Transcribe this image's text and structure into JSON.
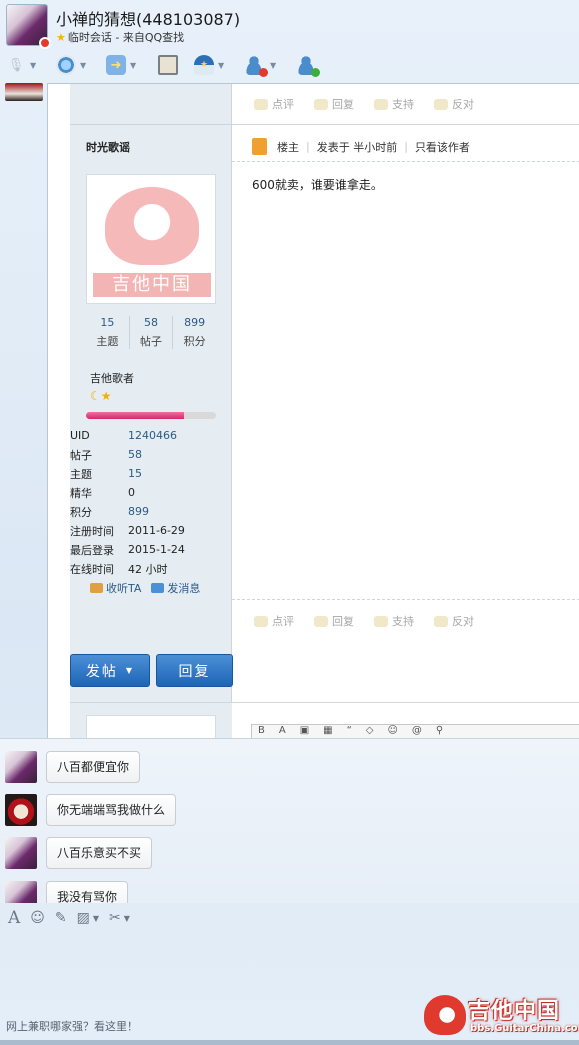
{
  "header": {
    "contact_name": "小禅的猜想(448103087)",
    "subtitle": "临时会话 - 来自QQ查找"
  },
  "toolbar": {
    "items": [
      {
        "icon": "microphone-icon",
        "has_dropdown": true
      },
      {
        "icon": "camera-icon",
        "has_dropdown": true
      },
      {
        "icon": "file-transfer-icon",
        "has_dropdown": true
      },
      {
        "icon": "screen-icon",
        "has_dropdown": false
      },
      {
        "icon": "app-icon",
        "has_dropdown": true
      },
      {
        "icon": "block-user-icon",
        "has_dropdown": true
      },
      {
        "icon": "add-user-icon",
        "has_dropdown": false
      }
    ]
  },
  "forum": {
    "actions": [
      "点评",
      "回复",
      "支持",
      "反对"
    ],
    "poster": {
      "name": "时光歌谣",
      "avatar_text": "吉他中国",
      "stats": [
        {
          "num": "15",
          "label": "主题"
        },
        {
          "num": "58",
          "label": "帖子"
        },
        {
          "num": "899",
          "label": "积分"
        }
      ],
      "rank": "吉他歌者",
      "progress": 0.75,
      "info": [
        {
          "k": "UID",
          "v": "1240466",
          "link": true
        },
        {
          "k": "帖子",
          "v": "58",
          "link": true
        },
        {
          "k": "主题",
          "v": "15",
          "link": true
        },
        {
          "k": "精华",
          "v": "0",
          "link": false
        },
        {
          "k": "积分",
          "v": "899",
          "link": true
        },
        {
          "k": "注册时间",
          "v": "2011-6-29",
          "link": false
        },
        {
          "k": "最后登录",
          "v": "2015-1-24",
          "link": false
        },
        {
          "k": "在线时间",
          "v": "42 小时",
          "link": false
        }
      ],
      "follow_label": "收听TA",
      "message_label": "发消息"
    },
    "post_meta": {
      "floor": "楼主",
      "posted": "发表于 半小时前",
      "only_author": "只看该作者"
    },
    "content": "600就卖，谁要谁拿走。",
    "post_button": "发帖",
    "reply_button": "回复"
  },
  "chat": {
    "messages": [
      {
        "avatar": "boy-avatar",
        "text": "八百都便宜你"
      },
      {
        "avatar": "mask-avatar",
        "text": "你无端端骂我做什么"
      },
      {
        "avatar": "boy-avatar",
        "text": "八百乐意买不买"
      },
      {
        "avatar": "boy-avatar",
        "text": "我没有骂你"
      }
    ]
  },
  "input_toolbar": {
    "items": [
      "font-icon",
      "emoji-icon",
      "edit-icon",
      "image-icon",
      "scissors-icon"
    ]
  },
  "footer": {
    "ad_link": "网上兼职哪家强？看这里！",
    "brand_name": "吉他中国",
    "brand_url": "bbs.GuitarChina.com"
  },
  "colors": {
    "accent": "#2c5a86",
    "button": "#1f65b7",
    "brand_red": "#e03a2e"
  }
}
